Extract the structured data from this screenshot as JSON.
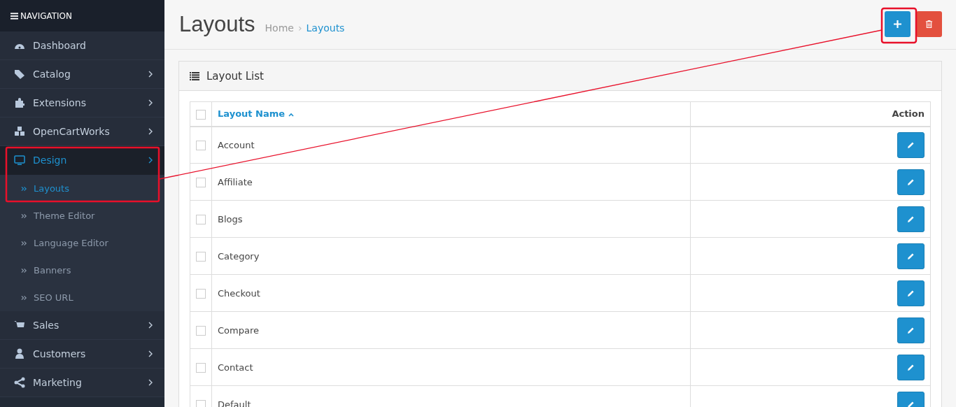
{
  "sidebar": {
    "title": "NAVIGATION",
    "items": [
      {
        "label": "Dashboard",
        "kind": "dashboard",
        "has_submenu": false,
        "selected": false
      },
      {
        "label": "Catalog",
        "kind": "tag",
        "has_submenu": true,
        "selected": false
      },
      {
        "label": "Extensions",
        "kind": "puzzle",
        "has_submenu": true,
        "selected": false
      },
      {
        "label": "OpenCartWorks",
        "kind": "cubes",
        "has_submenu": true,
        "selected": false
      },
      {
        "label": "Design",
        "kind": "monitor",
        "has_submenu": true,
        "selected": true,
        "children": [
          {
            "label": "Layouts",
            "selected": true
          },
          {
            "label": "Theme Editor",
            "selected": false
          },
          {
            "label": "Language Editor",
            "selected": false
          },
          {
            "label": "Banners",
            "selected": false
          },
          {
            "label": "SEO URL",
            "selected": false
          }
        ]
      },
      {
        "label": "Sales",
        "kind": "cart",
        "has_submenu": true,
        "selected": false
      },
      {
        "label": "Customers",
        "kind": "user",
        "has_submenu": true,
        "selected": false
      },
      {
        "label": "Marketing",
        "kind": "share",
        "has_submenu": true,
        "selected": false
      }
    ]
  },
  "header": {
    "title": "Layouts",
    "separator": "›",
    "breadcrumb": [
      {
        "label": "Home",
        "selected": false
      },
      {
        "label": "Layouts",
        "selected": true
      }
    ]
  },
  "panel": {
    "title": "Layout List",
    "table": {
      "select_all_checked": false,
      "columns": [
        "Layout Name",
        "Action"
      ],
      "rows": [
        {
          "name": "Account",
          "checked": false
        },
        {
          "name": "Affiliate",
          "checked": false
        },
        {
          "name": "Blogs",
          "checked": false
        },
        {
          "name": "Category",
          "checked": false
        },
        {
          "name": "Checkout",
          "checked": false
        },
        {
          "name": "Compare",
          "checked": false
        },
        {
          "name": "Contact",
          "checked": false
        },
        {
          "name": "Default",
          "checked": false
        }
      ]
    }
  }
}
